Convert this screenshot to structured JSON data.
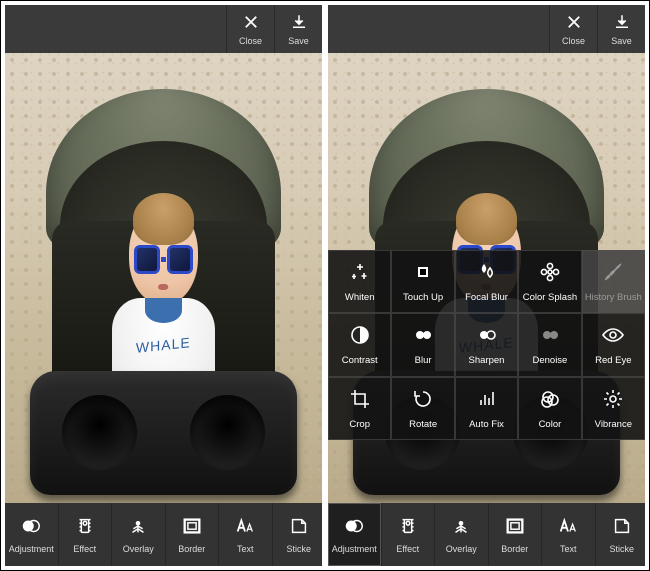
{
  "top": {
    "close": "Close",
    "save": "Save"
  },
  "bottom": [
    {
      "key": "adjustment",
      "label": "Adjustment"
    },
    {
      "key": "effect",
      "label": "Effect"
    },
    {
      "key": "overlay",
      "label": "Overlay"
    },
    {
      "key": "border",
      "label": "Border"
    },
    {
      "key": "text",
      "label": "Text"
    },
    {
      "key": "sticker",
      "label": "Sticke"
    }
  ],
  "left": {
    "selected_bottom": null
  },
  "right": {
    "selected_bottom": "adjustment"
  },
  "adjustment_tools": [
    [
      {
        "key": "whiten",
        "label": "Whiten",
        "icon": "sparkle"
      },
      {
        "key": "touchup",
        "label": "Touch Up",
        "icon": "patch"
      },
      {
        "key": "focalblur",
        "label": "Focal Blur",
        "icon": "drops"
      },
      {
        "key": "colorsplash",
        "label": "Color Splash",
        "icon": "flower"
      },
      {
        "key": "historybrush",
        "label": "History Brush",
        "icon": "brush",
        "disabled": true
      }
    ],
    [
      {
        "key": "contrast",
        "label": "Contrast",
        "icon": "halfcircle"
      },
      {
        "key": "blur",
        "label": "Blur",
        "icon": "dots-solid"
      },
      {
        "key": "sharpen",
        "label": "Sharpen",
        "icon": "dots-outline"
      },
      {
        "key": "denoise",
        "label": "Denoise",
        "icon": "dots-gray"
      },
      {
        "key": "redeye",
        "label": "Red Eye",
        "icon": "eye"
      }
    ],
    [
      {
        "key": "crop",
        "label": "Crop",
        "icon": "crop"
      },
      {
        "key": "rotate",
        "label": "Rotate",
        "icon": "rotate"
      },
      {
        "key": "autofix",
        "label": "Auto Fix",
        "icon": "bars"
      },
      {
        "key": "color",
        "label": "Color",
        "icon": "venn"
      },
      {
        "key": "vibrance",
        "label": "Vibrance",
        "icon": "sun"
      }
    ]
  ]
}
